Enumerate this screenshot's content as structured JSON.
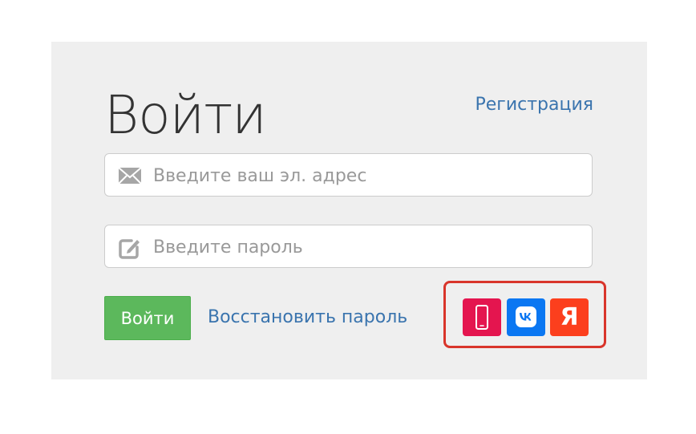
{
  "login": {
    "title": "Войти",
    "register_label": "Регистрация",
    "email_placeholder": "Введите ваш эл. адрес",
    "password_placeholder": "Введите пароль",
    "submit_label": "Войти",
    "restore_label": "Восстановить пароль"
  },
  "icons": {
    "email": "envelope-icon",
    "password": "edit-icon"
  },
  "social": [
    {
      "name": "phone-icon",
      "color": "#e4154f"
    },
    {
      "name": "vk-icon",
      "color": "#0b77f2"
    },
    {
      "name": "yandex-icon",
      "color": "#fc3f1d",
      "label": "Я"
    }
  ],
  "colors": {
    "accent_link": "#3a74ae",
    "submit": "#5cb85c",
    "highlight_border": "#d9352b",
    "panel_bg": "#efefef"
  }
}
